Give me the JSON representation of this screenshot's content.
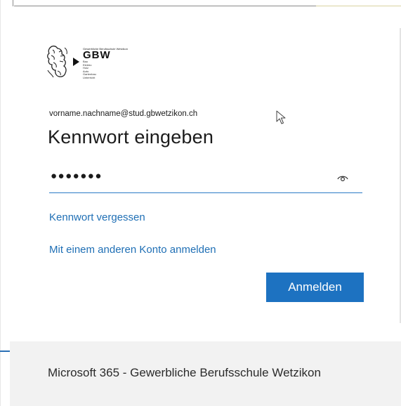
{
  "logo": {
    "name": "GBW",
    "tagline": "Gewerbliche Berufsschule Wetzikon",
    "subtitle_lines": [
      "Bau",
      "Elektro",
      "Holz",
      "Auto",
      "Gartenbau",
      "Unterricht"
    ]
  },
  "account": {
    "identifier": "vorname.nachname@stud.gbwetzikon.ch"
  },
  "page": {
    "title": "Kennwort eingeben"
  },
  "password": {
    "masked_value": "●●●●●●●",
    "reveal_icon": "eye-icon"
  },
  "links": {
    "forgot": "Kennwort vergessen",
    "other_account": "Mit einem anderen Konto anmelden"
  },
  "actions": {
    "submit_label": "Anmelden"
  },
  "footer": {
    "text": "Microsoft 365 - Gewerbliche Berufsschule Wetzikon"
  },
  "colors": {
    "accent": "#1d72c1",
    "link": "#1f6fb5",
    "footer_bg": "#f2f2f2",
    "text": "#1b1b1b"
  }
}
